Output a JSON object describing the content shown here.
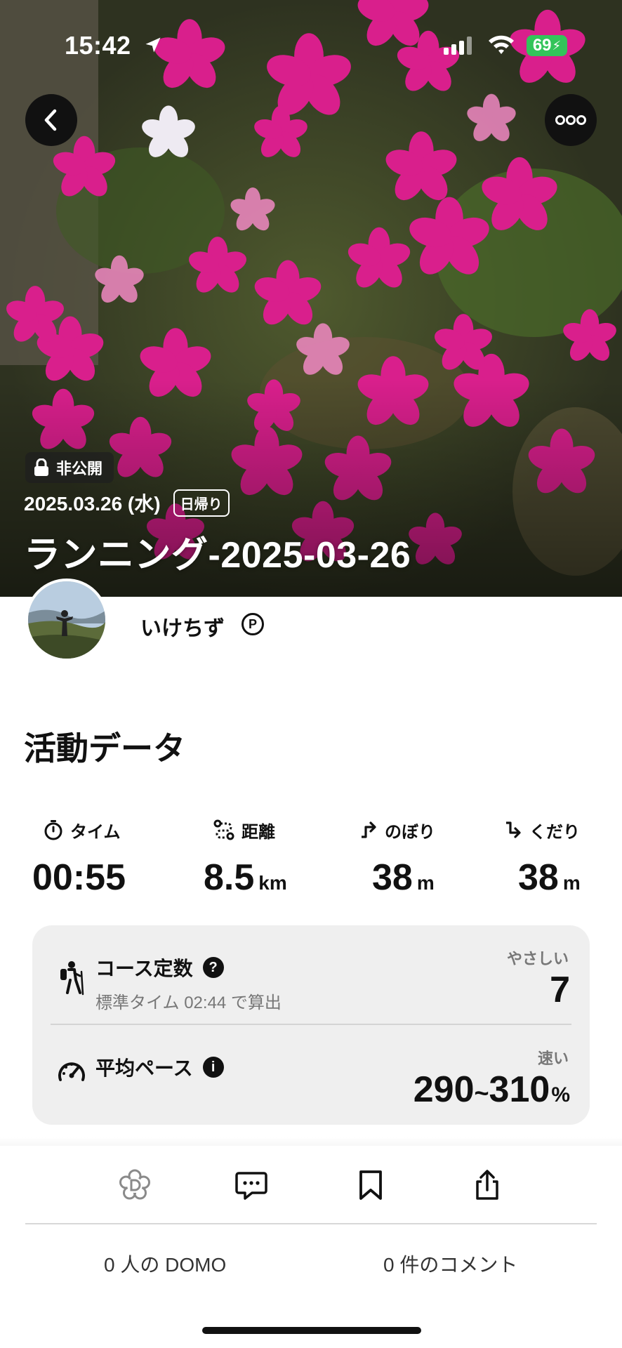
{
  "status_bar": {
    "time": "15:42",
    "battery": "69",
    "icons": [
      "location-arrow-icon",
      "signal-icon",
      "wifi-icon",
      "battery-charging-icon"
    ]
  },
  "header": {
    "back_icon": "chevron-left-icon",
    "more_icon": "ellipsis-icon",
    "private_label": "非公開",
    "date": "2025.03.26 (水)",
    "trip_type": "日帰り",
    "title": "ランニング-2025-03-26"
  },
  "author": {
    "name": "いけちず",
    "badge": "P"
  },
  "activity": {
    "section_title": "活動データ",
    "stats": {
      "time": {
        "label": "タイム",
        "value": "00:55",
        "icon": "stopwatch-icon"
      },
      "distance": {
        "label": "距離",
        "value": "8.5",
        "unit": "km",
        "icon": "route-icon"
      },
      "ascent": {
        "label": "のぼり",
        "value": "38",
        "unit": "m",
        "icon": "ascent-arrow-icon"
      },
      "descent": {
        "label": "くだり",
        "value": "38",
        "unit": "m",
        "icon": "descent-arrow-icon"
      }
    },
    "course": {
      "title": "コース定数",
      "help": "?",
      "subtitle": "標準タイム 02:44 で算出",
      "level": "やさしい",
      "value": "7",
      "icon": "hiker-icon"
    },
    "pace": {
      "title": "平均ペース",
      "help": "i",
      "level": "速い",
      "value_low": "290",
      "tilde": "~",
      "value_high": "310",
      "unit": "%",
      "icon": "speedometer-icon"
    }
  },
  "actions": {
    "icons": [
      "domo-flower-icon",
      "comment-icon",
      "bookmark-icon",
      "share-icon"
    ],
    "domo_count": "0 人の DOMO",
    "comment_count": "0 件のコメント"
  },
  "colors": {
    "battery_green": "#33c45a",
    "card_bg": "#efefef",
    "text_primary": "#111111",
    "text_secondary": "#777777"
  }
}
